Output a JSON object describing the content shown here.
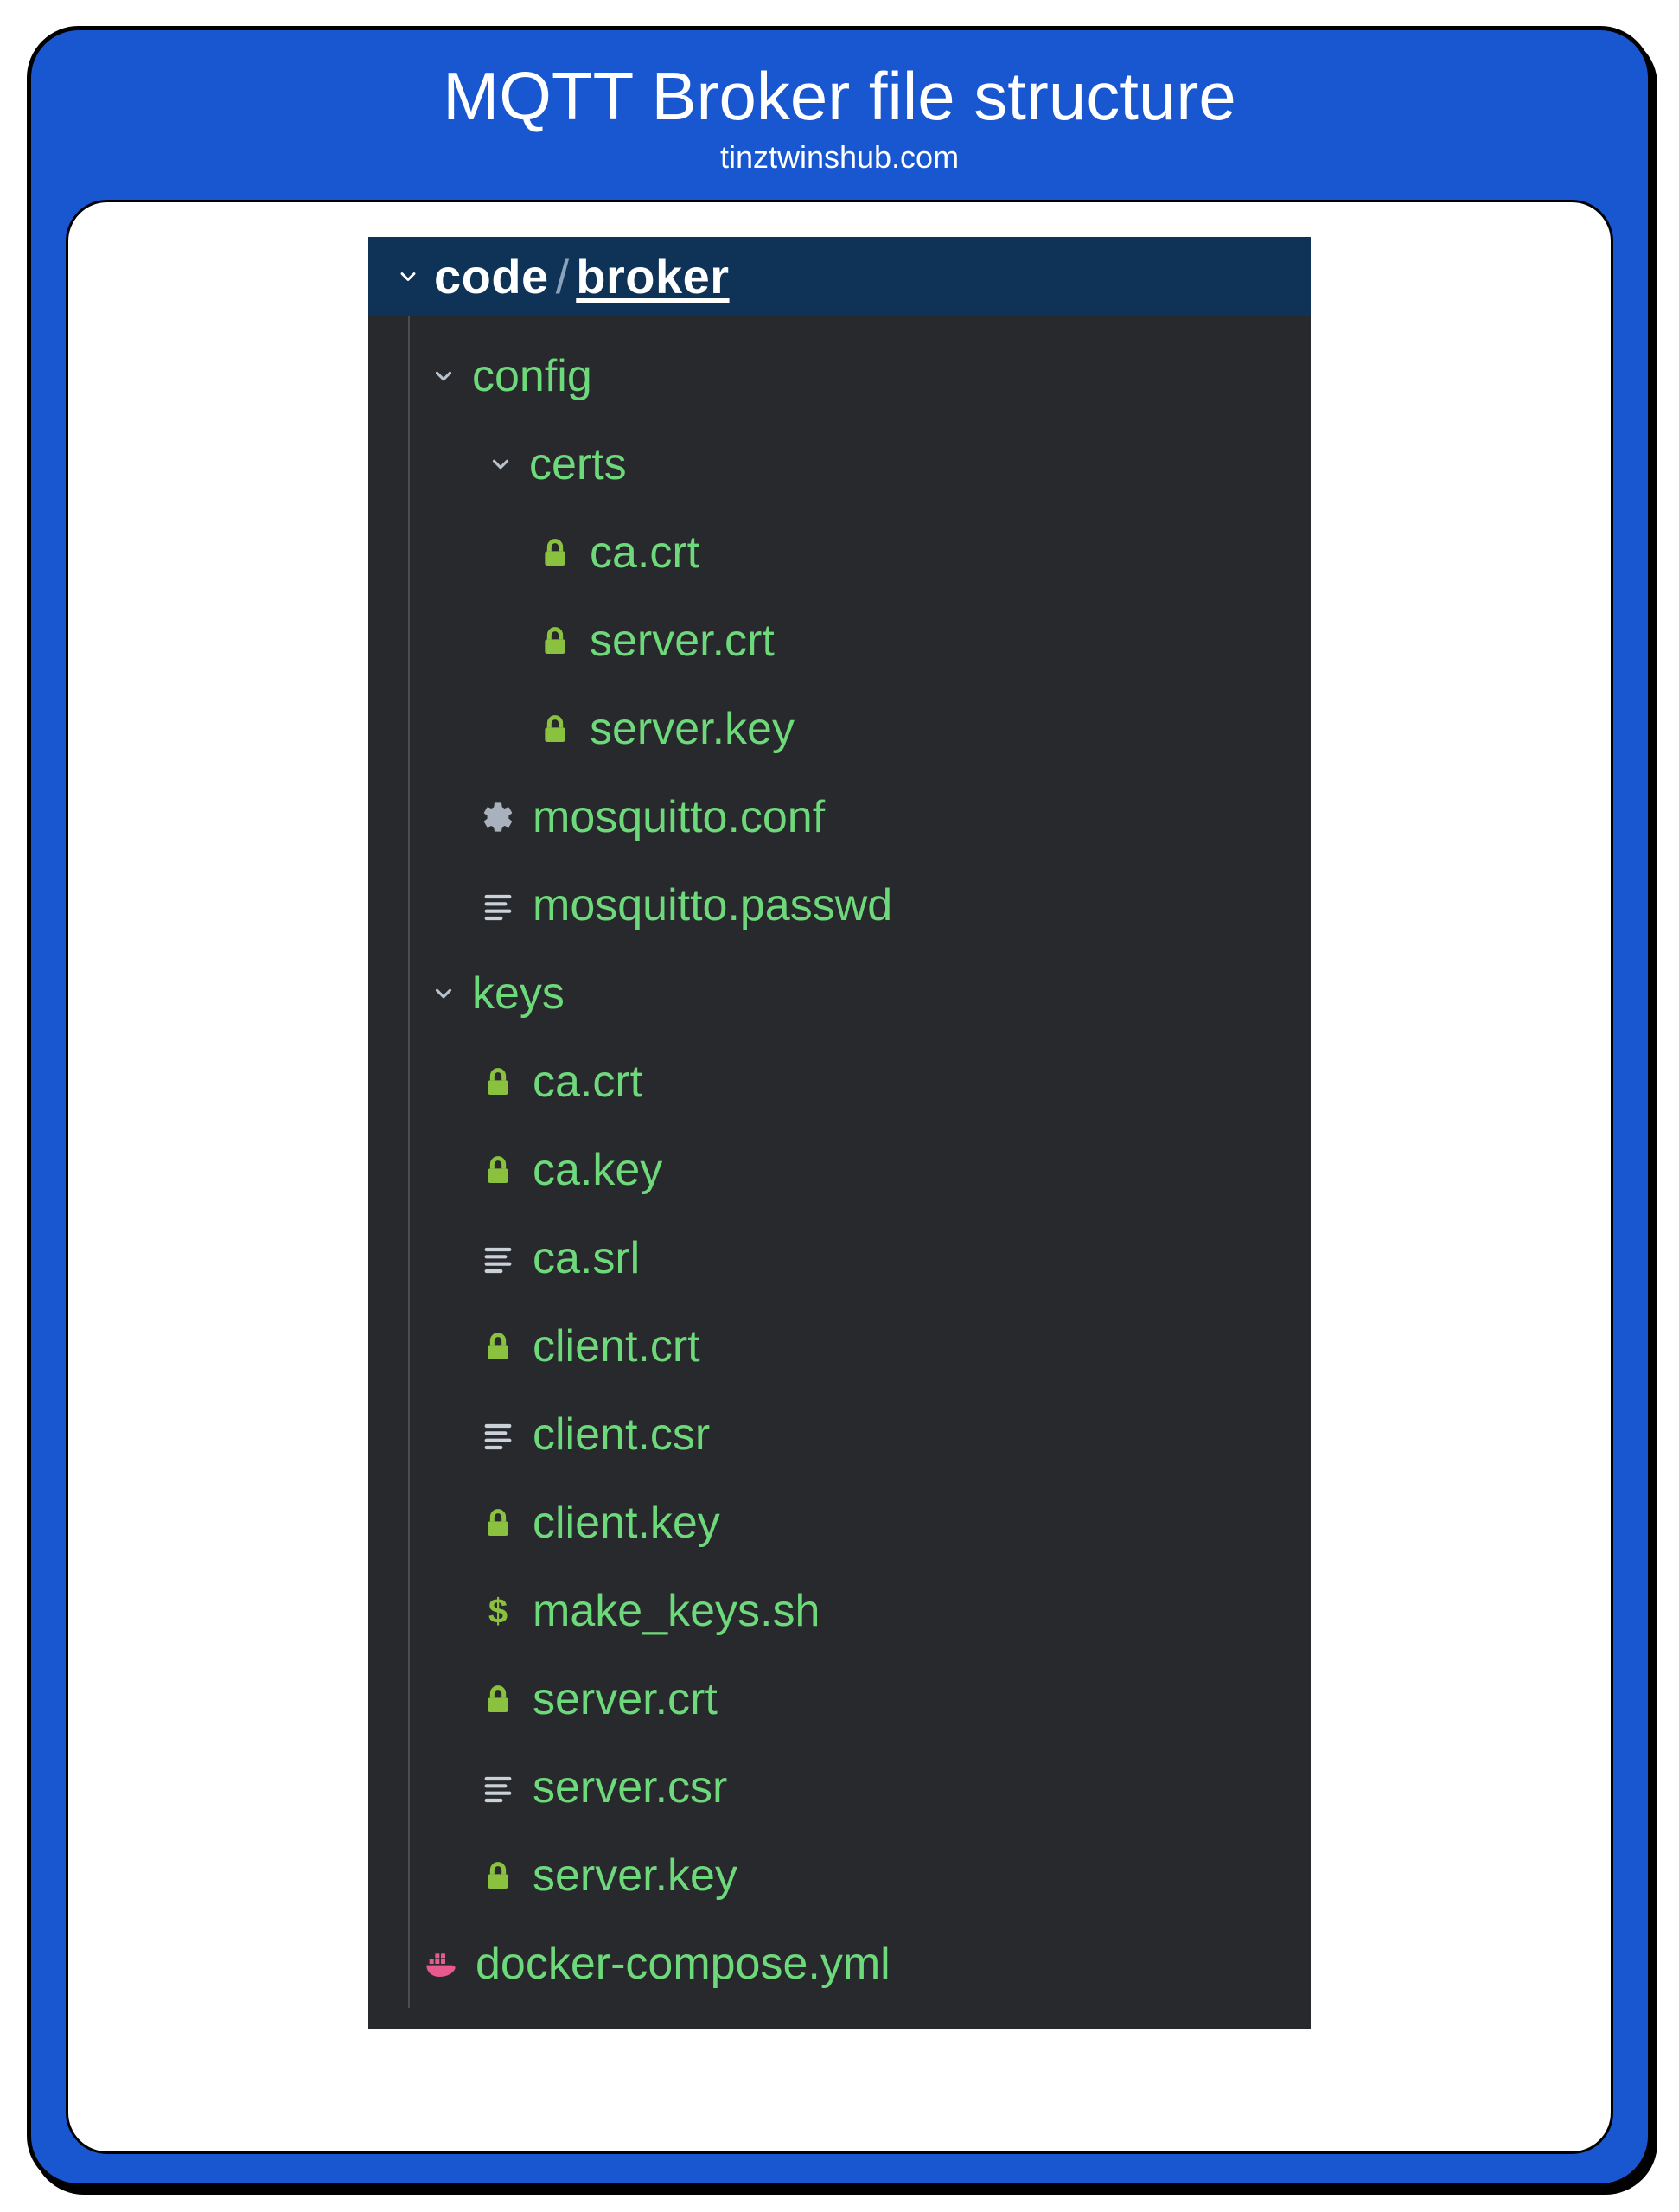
{
  "frame": {
    "title": "MQTT Broker file structure",
    "subtitle": "tinztwinshub.com"
  },
  "header": {
    "root": "code",
    "separator": "/",
    "current": "broker"
  },
  "tree": {
    "folder_config": "config",
    "folder_certs": "certs",
    "file_ca_crt_1": "ca.crt",
    "file_server_crt_1": "server.crt",
    "file_server_key_1": "server.key",
    "file_mosquitto_conf": "mosquitto.conf",
    "file_mosquitto_passwd": "mosquitto.passwd",
    "folder_keys": "keys",
    "file_ca_crt_2": "ca.crt",
    "file_ca_key": "ca.key",
    "file_ca_srl": "ca.srl",
    "file_client_crt": "client.crt",
    "file_client_csr": "client.csr",
    "file_client_key": "client.key",
    "file_make_keys_sh": "make_keys.sh",
    "file_server_crt_2": "server.crt",
    "file_server_csr": "server.csr",
    "file_server_key_2": "server.key",
    "file_docker_compose": "docker-compose.yml"
  },
  "colors": {
    "frame_bg": "#1957D0",
    "panel_bg": "#27292D",
    "header_bg": "#0E3356",
    "file_green": "#6ED97A",
    "lock_green": "#8AC23F",
    "gear_gray": "#A9B2BC",
    "text_gray": "#C9D1D9",
    "dollar_green": "#8AC23F",
    "docker_pink": "#E85A8B"
  }
}
